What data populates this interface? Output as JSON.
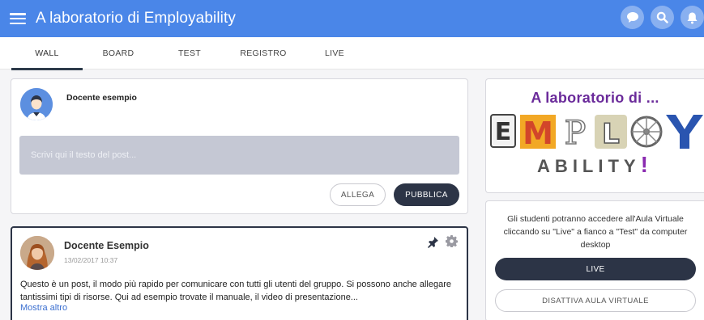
{
  "header": {
    "title": "A laboratorio di Employability",
    "icons": [
      "menu-icon",
      "chat-icon",
      "search-icon",
      "bell-icon"
    ],
    "color": "#4a86e8"
  },
  "tabs": [
    {
      "label": "WALL",
      "active": true
    },
    {
      "label": "BOARD",
      "active": false
    },
    {
      "label": "TEST",
      "active": false
    },
    {
      "label": "REGISTRO",
      "active": false
    },
    {
      "label": "LIVE",
      "active": false
    }
  ],
  "composer": {
    "author": "Docente esempio",
    "placeholder": "Scrivi qui il testo del post...",
    "attach_label": "ALLEGA",
    "publish_label": "PUBBLICA"
  },
  "post": {
    "author": "Docente Esempio",
    "date": "13/02/2017 10:37",
    "body": "Questo è un post, il modo più rapido per comunicare con tutti gli utenti del gruppo. Si possono anche allegare tantissimi tipi di risorse. Qui ad esempio trovate il manuale, il video di presentazione...",
    "more_label": "Mostra altro"
  },
  "banner": {
    "line1": "A laboratorio di ...",
    "letters": [
      "E",
      "M",
      "P",
      "L",
      "O",
      "Y"
    ],
    "line2": "ABILITY",
    "excl": "!"
  },
  "virtual_class": {
    "info": "Gli studenti potranno accedere all'Aula Virtuale cliccando su \"Live\" a fianco a \"Test\" da computer desktop",
    "live_label": "LIVE",
    "disable_label": "DISATTIVA AULA VIRTUALE"
  },
  "colors": {
    "accent_dark": "#2c3446",
    "input_bg": "#c5c8d4",
    "link": "#3b6fd0"
  }
}
